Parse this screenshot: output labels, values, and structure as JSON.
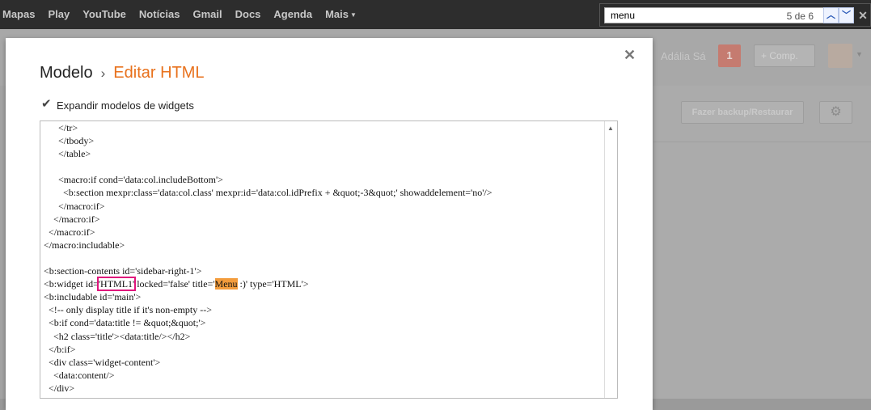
{
  "topbar": {
    "items": [
      "Mapas",
      "Play",
      "YouTube",
      "Notícias",
      "Gmail",
      "Docs",
      "Agenda",
      "Mais"
    ]
  },
  "findbar": {
    "query": "menu",
    "count": "5 de 6"
  },
  "background": {
    "user_name": "Adália Sá",
    "notifications": "1",
    "share_label": "+ Comp.",
    "backup_label": "Fazer backup/Restaurar"
  },
  "dialog": {
    "breadcrumb_root": "Modelo",
    "breadcrumb_sep": "›",
    "breadcrumb_current": "Editar HTML",
    "expand_label": "Expandir modelos de widgets",
    "expand_checked": true,
    "code_lines": [
      "      </tr>",
      "      </tbody>",
      "      </table>",
      "",
      "      <macro:if cond='data:col.includeBottom'>",
      "        <b:section mexpr:class='data:col.class' mexpr:id='data:col.idPrefix + &quot;-3&quot;' showaddelement='no'/>",
      "      </macro:if>",
      "    </macro:if>",
      "  </macro:if>",
      "</macro:includable>",
      "",
      "<b:section-contents id='sidebar-right-1'>",
      "<b:widget id='HTML1' locked='false' title='Menu :)' type='HTML'>",
      "<b:includable id='main'>",
      "  <!-- only display title if it's non-empty -->",
      "  <b:if cond='data:title != &quot;&quot;'>",
      "    <h2 class='title'><data:title/></h2>",
      "  </b:if>",
      "  <div class='widget-content'>",
      "    <data:content/>",
      "  </div>"
    ]
  }
}
